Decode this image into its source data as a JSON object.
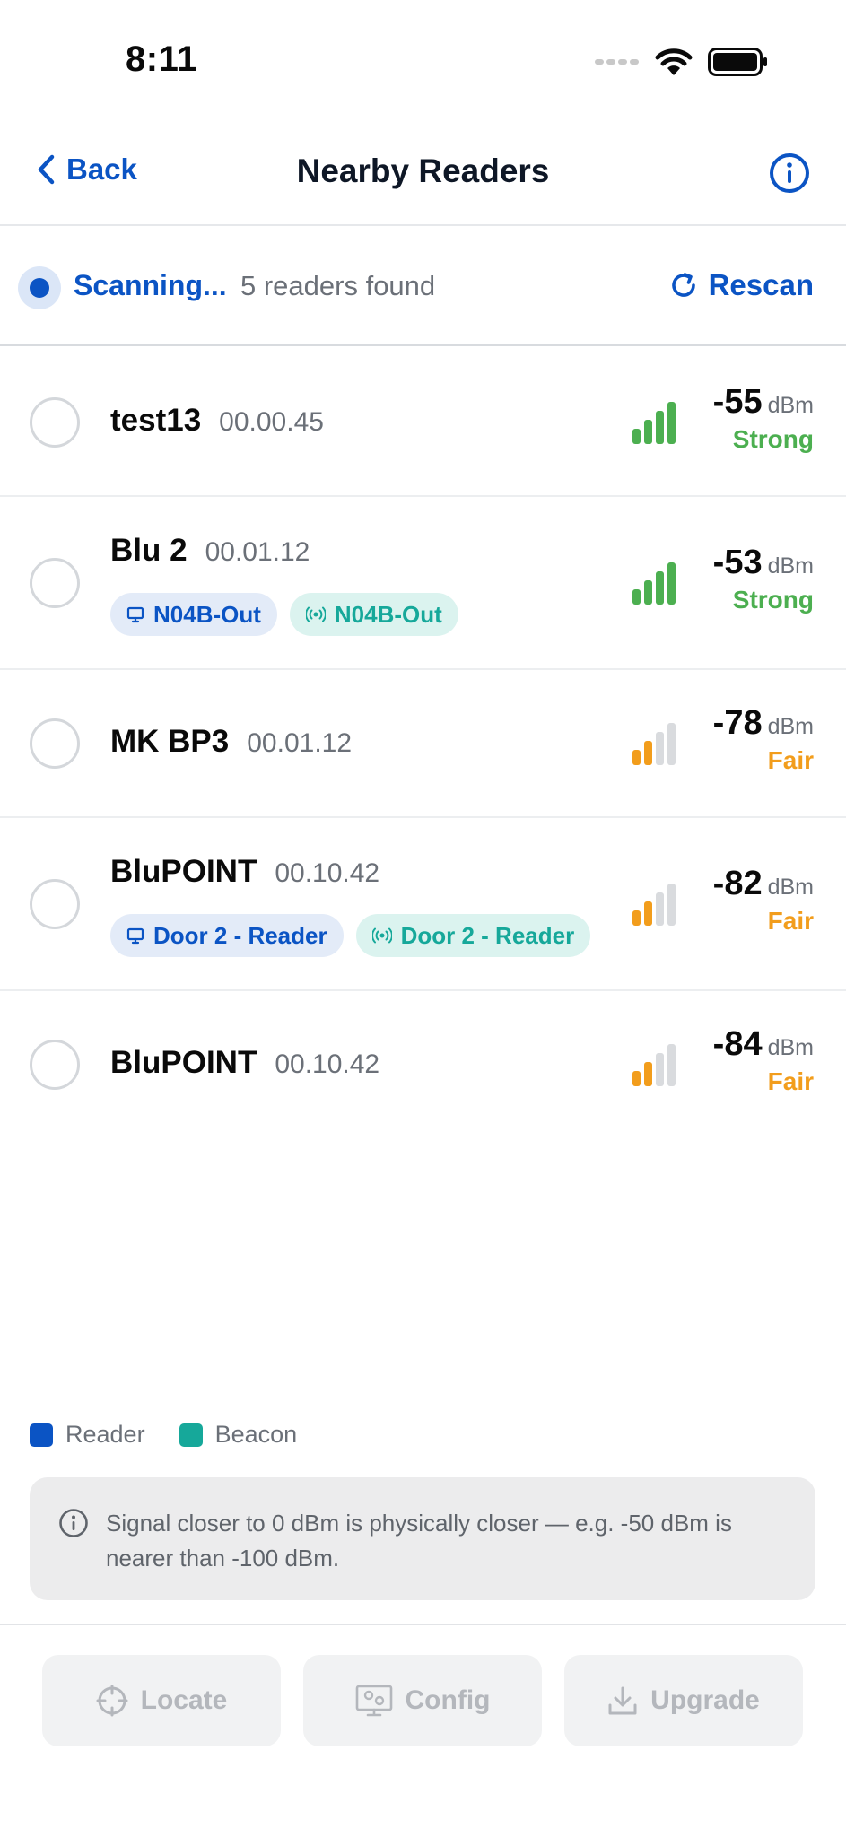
{
  "status_bar": {
    "time": "8:11"
  },
  "nav": {
    "back_label": "Back",
    "title": "Nearby Readers"
  },
  "scan": {
    "label": "Scanning...",
    "count": "5 readers found",
    "rescan_label": "Rescan"
  },
  "readers": [
    {
      "name": "test13",
      "firmware": "00.00.45",
      "dbm": "-55",
      "unit": "dBm",
      "quality": "Strong",
      "signal_bars": 4,
      "tags": []
    },
    {
      "name": "Blu 2",
      "firmware": "00.01.12",
      "dbm": "-53",
      "unit": "dBm",
      "quality": "Strong",
      "signal_bars": 4,
      "tags": [
        {
          "type": "reader",
          "label": "N04B-Out"
        },
        {
          "type": "beacon",
          "label": "N04B-Out"
        }
      ]
    },
    {
      "name": "MK BP3",
      "firmware": "00.01.12",
      "dbm": "-78",
      "unit": "dBm",
      "quality": "Fair",
      "signal_bars": 2,
      "tags": []
    },
    {
      "name": "BluPOINT",
      "firmware": "00.10.42",
      "dbm": "-82",
      "unit": "dBm",
      "quality": "Fair",
      "signal_bars": 2,
      "tags": [
        {
          "type": "reader",
          "label": "Door 2 - Reader"
        },
        {
          "type": "beacon",
          "label": "Door 2 - Reader"
        }
      ]
    },
    {
      "name": "BluPOINT",
      "firmware": "00.10.42",
      "dbm": "-84",
      "unit": "dBm",
      "quality": "Fair",
      "signal_bars": 2,
      "tags": []
    }
  ],
  "legend": [
    {
      "label": "Reader",
      "color": "#0b54c4"
    },
    {
      "label": "Beacon",
      "color": "#16a89a"
    }
  ],
  "info_note": "Signal closer to 0 dBm is physically closer — e.g. -50 dBm is nearer than -100 dBm.",
  "actions": {
    "locate": "Locate",
    "config": "Config",
    "upgrade": "Upgrade"
  },
  "colors": {
    "accent": "#0b54c4",
    "beacon": "#16a89a",
    "strong": "#4caf50",
    "fair": "#f29d1c"
  }
}
